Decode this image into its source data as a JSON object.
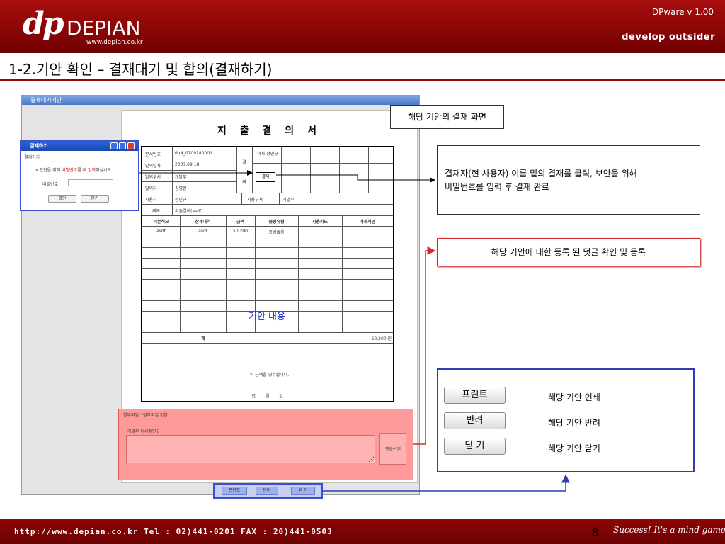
{
  "header": {
    "logo_mark": "dp",
    "logo_word": "DEPIAN",
    "logo_url": "www.depian.co.kr",
    "version": "DPware v 1.00",
    "slogan": "develop outsider"
  },
  "page_title": "1-2.기안 확인 – 결재대기 및 합의(결재하기)",
  "app_window": {
    "title": "결재대기기안",
    "document": {
      "title": "지 출 결 의 서",
      "fields": {
        "doc_no_label": "문서번호",
        "doc_no": "dir4_0709180001",
        "issue_date_label": "발의일자",
        "issue_date": "2007.09.18",
        "issue_dept_label": "발의부서",
        "issue_dept": "개발부",
        "issuer_label": "발의자",
        "issuer": "강명원",
        "user_label": "사용자",
        "user": "정민규",
        "use_dept_label": "사용부서",
        "use_dept": "개발부",
        "subject_label": "제목",
        "subject": "지출결의(asdf)"
      },
      "approval": {
        "col_label_top": "결",
        "col_label_bottom": "재",
        "approver": "이사 정민규",
        "approve_button": "결재"
      },
      "table_headers": [
        "기본적요",
        "상세내역",
        "금액",
        "증빙유형",
        "사용카드",
        "거래처명"
      ],
      "table_row": [
        "asdf",
        "asdf",
        "50,200",
        "증빙없음",
        "",
        ""
      ],
      "total_label": "계",
      "total_value": "50,200 원",
      "content_label": "기안 내용",
      "receipt_text": "위 금액을 영수합니다.",
      "date_line": "년 월 일"
    },
    "approve_dialog": {
      "title": "결재하기",
      "subtitle": "결재하기",
      "message_prefix": "» 안전을 위해 ",
      "message_hl1": "비밀번호",
      "message_mid": "를 ",
      "message_hl2": "재 입력",
      "message_suffix": "하십시오",
      "password_label": "비밀번호",
      "ok_button": "확인",
      "close_button": "닫기"
    },
    "attachment": {
      "title": "첨부파일 : 첨부파일 없음",
      "comment": "개발부 이사정민규",
      "comment_button": "댓글쓰기"
    },
    "bottom_buttons": [
      "프린트",
      "반려",
      "닫 기"
    ]
  },
  "callouts": {
    "screen": "해당 기안의 결재 화면",
    "approver_line1": "결재자(현 사용자) 이름 밑의 결재를 클릭, 보안을 위해",
    "approver_line2": "비밀번호를 입력 후 결재 완료",
    "comment": "해당 기안에 대한 등록 된 덧글 확인 및 등록",
    "buttons": [
      {
        "label": "프린트",
        "desc": "해당 기안 인쇄"
      },
      {
        "label": "반려",
        "desc": "해당 기안 반려"
      },
      {
        "label": "닫 기",
        "desc": "해당 기안 닫기"
      }
    ]
  },
  "footer": {
    "contact": "http://www.depian.co.kr   Tel : 02)441-0201   FAX : 20)441-0503",
    "page_number": "8",
    "slogan": "Success! It's a mind game!"
  },
  "colors": {
    "brand_red": "#7a0303",
    "highlight_blue": "#2c3db5",
    "highlight_red": "#d32b2b",
    "attachment_fill": "#ff9a9a"
  }
}
